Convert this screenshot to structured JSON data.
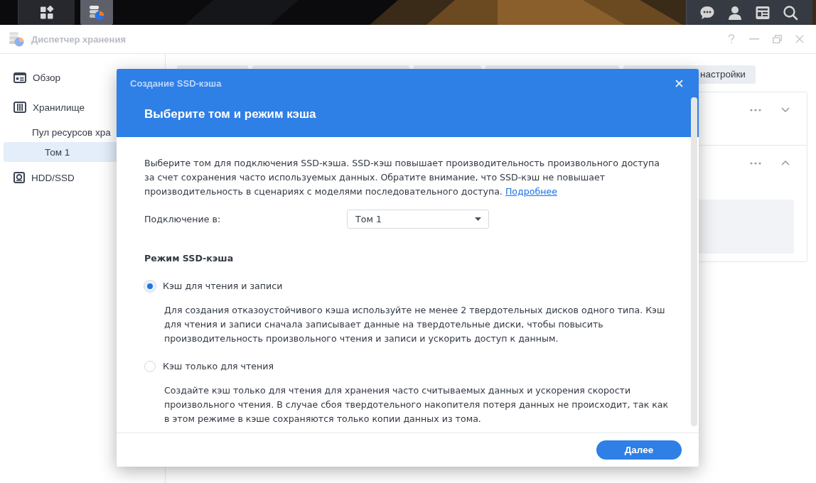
{
  "taskbar": {
    "buttons": [
      {
        "kind": "apps",
        "selected": false
      },
      {
        "kind": "storage",
        "selected": true
      }
    ],
    "tray": [
      {
        "kind": "chat"
      },
      {
        "kind": "user"
      },
      {
        "kind": "widgets"
      },
      {
        "kind": "search"
      }
    ]
  },
  "window": {
    "title": "Диспетчер хранения"
  },
  "sidebar": {
    "items": [
      {
        "label": "Обзор",
        "kind": "overview",
        "selected": false
      },
      {
        "label": "Хранилище",
        "kind": "storage",
        "selected": false,
        "children": [
          {
            "label": "Пул ресурсов хра",
            "selected": false,
            "children": [
              {
                "label": "Том 1",
                "selected": true
              }
            ]
          }
        ]
      },
      {
        "label": "HDD/SSD",
        "kind": "disk",
        "selected": false
      }
    ]
  },
  "tabs": [
    {
      "label": "настройки",
      "selected": false
    }
  ],
  "cards": [
    {
      "expanded": false
    },
    {
      "expanded": true
    }
  ],
  "dialog": {
    "title": "Создание SSD-кэша",
    "heading": "Выберите том и режим кэша",
    "intro": "Выберите том для подключения SSD-кэша. SSD-кэш повышает производительность произвольного доступа за счет сохранения часто используемых данных. Обратите внимание, что SSD-кэш не повышает производительность в сценариях с моделями последовательного доступа.",
    "link": "Подробнее",
    "volume": {
      "label": "Подключение в:",
      "value": "Том 1"
    },
    "mode_title": "Режим SSD-кэша",
    "modes": [
      {
        "label": "Кэш для чтения и записи",
        "description": "Для создания отказоустойчивого кэша используйте не менее 2 твердотельных дисков одного типа. Кэш для чтения и записи сначала записывает данные на твердотельные диски, чтобы повысить производительность произвольного чтения и записи и ускорить доступ к данным.",
        "selected": true
      },
      {
        "label": "Кэш только для чтения",
        "description": "Создайте кэш только для чтения для хранения часто считываемых данных и ускорения скорости произвольного чтения. В случае сбоя твердотельного накопителя потеря данных не происходит, так как в этом режиме в кэше сохраняются только копии данных из тома.",
        "selected": false
      }
    ],
    "next_button": "Далее"
  }
}
